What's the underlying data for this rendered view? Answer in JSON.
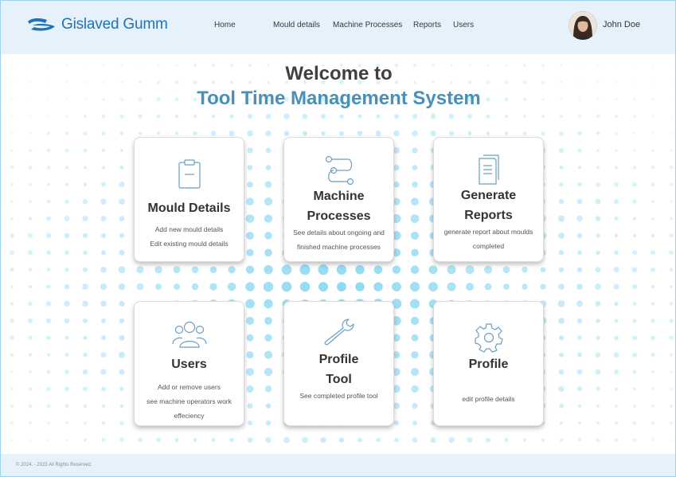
{
  "header": {
    "logo_text": "Gislaved Gumm",
    "nav": [
      "Home",
      "Mould details",
      "Machine Processes",
      "Reports",
      "Users"
    ],
    "user_name": "John Doe"
  },
  "main": {
    "welcome": "Welcome to",
    "system_title": "Tool Time Management System"
  },
  "cards": [
    {
      "title": "Mould Details",
      "desc": [
        "Add new mould details",
        "Edit existing mould details"
      ],
      "icon": "clipboard-icon"
    },
    {
      "title": [
        "Machine",
        "Processes"
      ],
      "desc": [
        "See details about ongoing and",
        "finished machine processes"
      ],
      "icon": "process-flow-icon"
    },
    {
      "title": [
        "Generate",
        "Reports"
      ],
      "desc": [
        "generate  report about moulds",
        "completed"
      ],
      "icon": "document-icon"
    },
    {
      "title": "Users",
      "desc": [
        "Add or remove users",
        "see machine operators work",
        "effeciency"
      ],
      "icon": "users-icon"
    },
    {
      "title": [
        "Profile",
        "Tool"
      ],
      "desc": [
        "See completed profile tool"
      ],
      "icon": "wrench-icon"
    },
    {
      "title": "Profile",
      "desc": [
        "edit profile details"
      ],
      "icon": "gear-icon"
    }
  ],
  "footer": {
    "copyright": "© 2024. - 2025 All Rights Reserved."
  },
  "colors": {
    "header_bg": "#e6f2fb",
    "brand": "#1f72b8",
    "accent_title": "#4a8fb5",
    "dot": "#8fd6f2"
  }
}
